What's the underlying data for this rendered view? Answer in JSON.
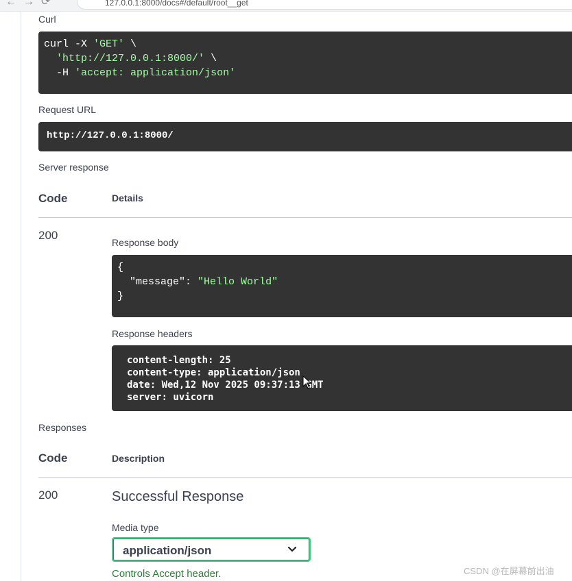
{
  "browser": {
    "url_fragment": "127.0.0.1:8000/docs#/default/root__get"
  },
  "curl": {
    "label": "Curl",
    "line1_cmd": "curl -X ",
    "line1_method": "'GET'",
    "line1_end": " \\",
    "line2_url": "'http://127.0.0.1:8000/'",
    "line2_end": " \\",
    "line3_flag": "-H ",
    "line3_header": "'accept: application/json'"
  },
  "request_url": {
    "label": "Request URL",
    "value": "http://127.0.0.1:8000/"
  },
  "server_response": {
    "label": "Server response",
    "col_code": "Code",
    "col_details": "Details",
    "code": "200",
    "body_label": "Response body",
    "body_open": "{",
    "body_key": "\"message\": ",
    "body_value": "\"Hello World\"",
    "body_close": "}",
    "headers_label": "Response headers",
    "headers": [
      "content-length: 25",
      "content-type: application/json",
      "date: Wed,12 Nov 2025 09:37:13 GMT",
      "server: uvicorn"
    ]
  },
  "responses": {
    "label": "Responses",
    "col_code": "Code",
    "col_description": "Description",
    "code": "200",
    "description": "Successful Response",
    "media_type_label": "Media type",
    "media_type_value": "application/json",
    "controls_text": "Controls Accept header."
  },
  "watermark": "CSDN @在屏幕前出油",
  "colors": {
    "code_bg": "#333333",
    "string_green": "#a2fca2",
    "select_border": "#49cc90",
    "controls_green": "#2f7d3a"
  }
}
